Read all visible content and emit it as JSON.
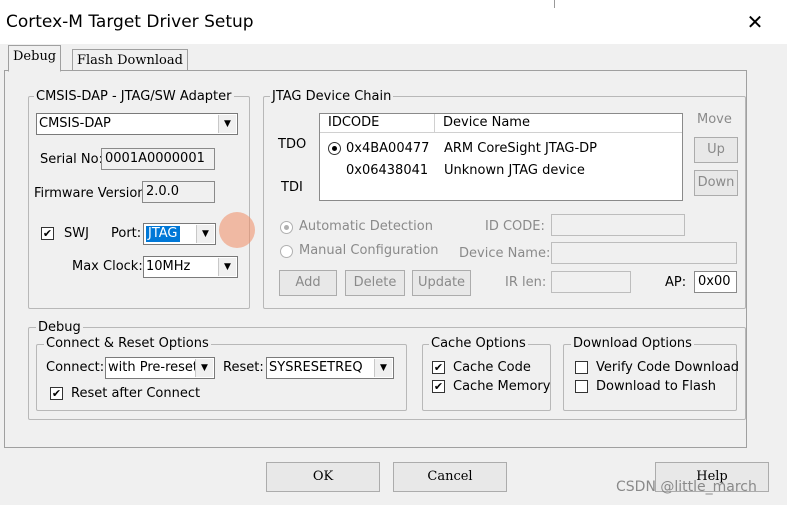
{
  "window": {
    "title": "Cortex-M Target Driver Setup"
  },
  "tabs": [
    {
      "label": "Debug",
      "active": true
    },
    {
      "label": "Flash Download",
      "active": false
    }
  ],
  "adapter": {
    "legend": "CMSIS-DAP - JTAG/SW Adapter",
    "selected": "CMSIS-DAP",
    "serial_label": "Serial No:",
    "serial_value": "0001A0000001",
    "firmware_label": "Firmware Version:",
    "firmware_value": "2.0.0",
    "swj_label": "SWJ",
    "swj_checked": true,
    "port_label": "Port:",
    "port_value": "JTAG",
    "maxclock_label": "Max Clock:",
    "maxclock_value": "10MHz"
  },
  "jtag": {
    "legend": "JTAG Device Chain",
    "tdo_label": "TDO",
    "tdi_label": "TDI",
    "columns": [
      "IDCODE",
      "Device Name"
    ],
    "rows": [
      {
        "idcode": "0x4BA00477",
        "name": "ARM CoreSight JTAG-DP",
        "selected": true
      },
      {
        "idcode": "0x06438041",
        "name": "Unknown JTAG device",
        "selected": false
      }
    ],
    "move_label": "Move",
    "up_label": "Up",
    "down_label": "Down",
    "auto_label": "Automatic Detection",
    "manual_label": "Manual Configuration",
    "idcode_label": "ID CODE:",
    "devname_label": "Device Name:",
    "add_label": "Add",
    "delete_label": "Delete",
    "update_label": "Update",
    "irlen_label": "IR len:",
    "ap_label": "AP:",
    "ap_value": "0x00"
  },
  "debug": {
    "legend": "Debug",
    "connect_legend": "Connect & Reset Options",
    "connect_label": "Connect:",
    "connect_value": "with Pre-reset",
    "reset_label": "Reset:",
    "reset_value": "SYSRESETREQ",
    "reset_after_label": "Reset after Connect",
    "cache_legend": "Cache Options",
    "cache_code_label": "Cache Code",
    "cache_memory_label": "Cache Memory",
    "download_legend": "Download Options",
    "verify_label": "Verify Code Download",
    "flash_label": "Download to Flash"
  },
  "footer": {
    "ok_label": "OK",
    "cancel_label": "Cancel",
    "help_label": "Help",
    "watermark": "CSDN @little_march"
  },
  "icons": {
    "close": "close-icon",
    "dropdown": "chevron-down-icon",
    "checkbox_checked": "checkmark-icon"
  }
}
